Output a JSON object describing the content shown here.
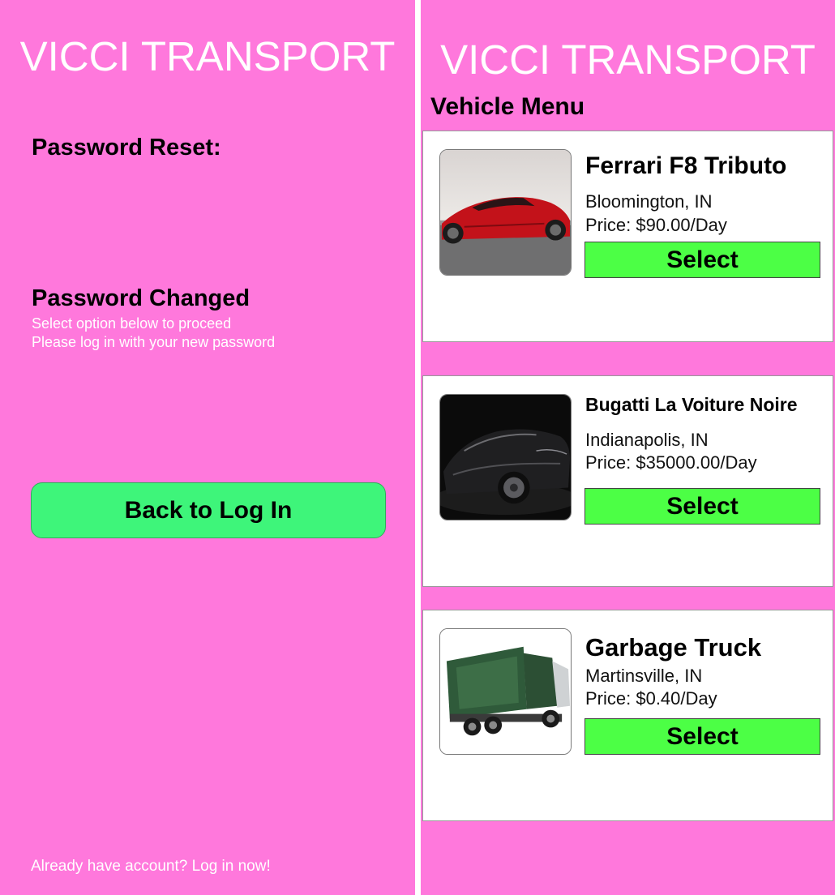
{
  "left_screen": {
    "app_title": "VICCI TRANSPORT",
    "reset_heading": "Password Reset:",
    "changed_heading": "Password Changed",
    "subtext_1": "Select option below to proceed",
    "subtext_2": "Please log in with your new password",
    "back_button_label": "Back to Log In",
    "footer_link": "Already have account? Log in now!"
  },
  "right_screen": {
    "app_title": "VICCI TRANSPORT",
    "menu_title": "Vehicle Menu",
    "vehicles": [
      {
        "name": "Ferrari F8 Tributo",
        "location": "Bloomington, IN",
        "price": "Price: $90.00/Day",
        "select_label": "Select",
        "image": "red-sports-car-image"
      },
      {
        "name": "Bugatti La Voiture Noire",
        "location": "Indianapolis, IN",
        "price": "Price: $35000.00/Day",
        "select_label": "Select",
        "image": "black-hypercar-image"
      },
      {
        "name": "Garbage Truck",
        "location": "Martinsville, IN",
        "price": "Price: $0.40/Day",
        "select_label": "Select",
        "image": "green-garbage-truck-image"
      }
    ]
  },
  "colors": {
    "background": "#ff78dc",
    "back_button": "#3ef57a",
    "select_button": "#4cff45",
    "card": "#ffffff"
  }
}
